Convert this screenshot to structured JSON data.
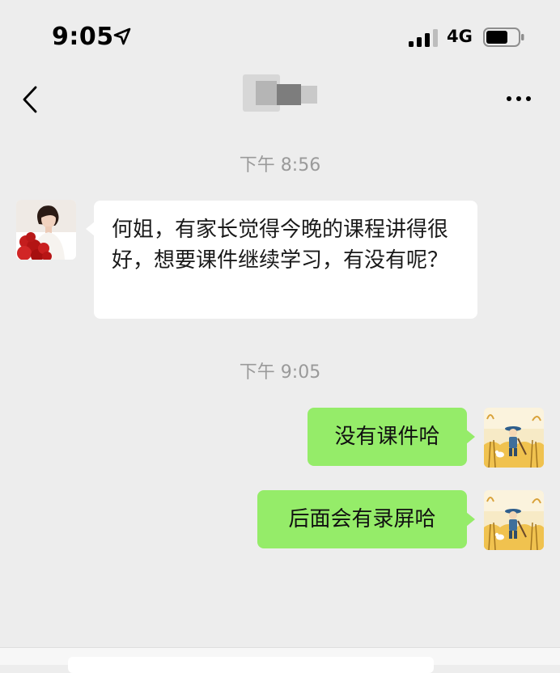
{
  "status_bar": {
    "time": "9:05",
    "network": "4G"
  },
  "nav": {
    "contact_name": ""
  },
  "messages": [
    {
      "type": "timestamp",
      "text": "下午 8:56"
    },
    {
      "type": "incoming",
      "text": "何姐，有家长觉得今晚的课程讲得很好，想要课件继续学习，有没有呢？"
    },
    {
      "type": "timestamp",
      "text": "下午 9:05"
    },
    {
      "type": "outgoing",
      "text": "没有课件哈"
    },
    {
      "type": "outgoing",
      "text": "后面会有录屏哈"
    }
  ],
  "colors": {
    "background": "#ededed",
    "outgoing_bubble": "#95ec69",
    "incoming_bubble": "#ffffff",
    "timestamp": "#9a9a9a"
  }
}
